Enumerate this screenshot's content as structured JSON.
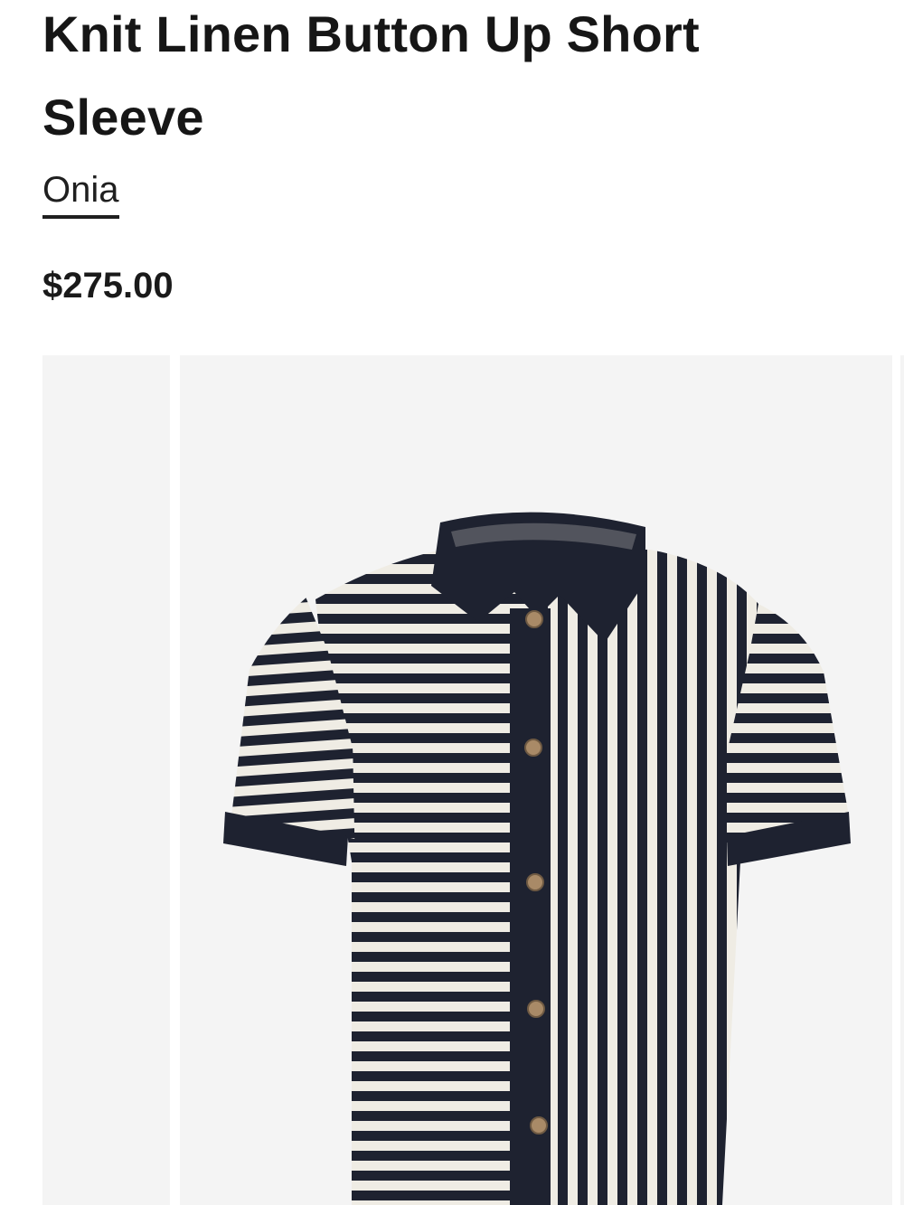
{
  "product": {
    "title": "Knit Linen Button Up Short Sleeve",
    "brand": "Onia",
    "price": "$275.00"
  },
  "gallery": {
    "thumbnail_icon": "product-thumbnail",
    "main_image_icon": "striped-knit-shirt-icon"
  },
  "colors": {
    "navy": "#1e2230",
    "cream": "#efece4",
    "button": "#a98a67",
    "image_bg": "#f4f4f4"
  }
}
